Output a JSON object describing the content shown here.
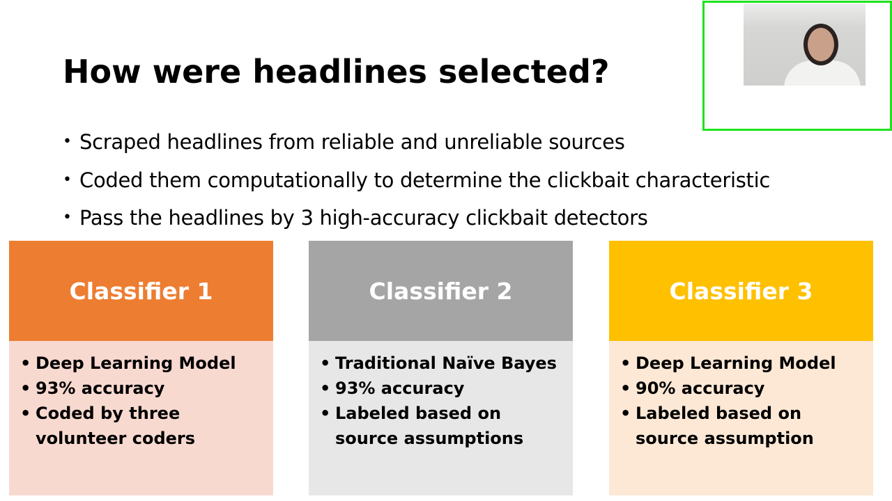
{
  "slide": {
    "title": "How were headlines selected?",
    "bullets": [
      "Scraped headlines from reliable and unreliable sources",
      "Coded them computationally to determine the clickbait characteristic",
      "Pass the headlines by 3 high-accuracy clickbait detectors"
    ],
    "bullet_symbol": "•",
    "classifiers": [
      {
        "title": "Classifier 1",
        "color": "#ED7D31",
        "points": [
          "Deep Learning Model",
          "93% accuracy",
          "Coded by three volunteer coders"
        ]
      },
      {
        "title": "Classifier 2",
        "color": "#A5A5A5",
        "points": [
          "Traditional Naïve Bayes",
          "93% accuracy",
          "Labeled based on source assumptions"
        ]
      },
      {
        "title": "Classifier 3",
        "color": "#FFC000",
        "points": [
          "Deep Learning Model",
          "90% accuracy",
          "Labeled based on source assumption"
        ]
      }
    ]
  },
  "webcam": {
    "border_color": "#1EE31E"
  }
}
